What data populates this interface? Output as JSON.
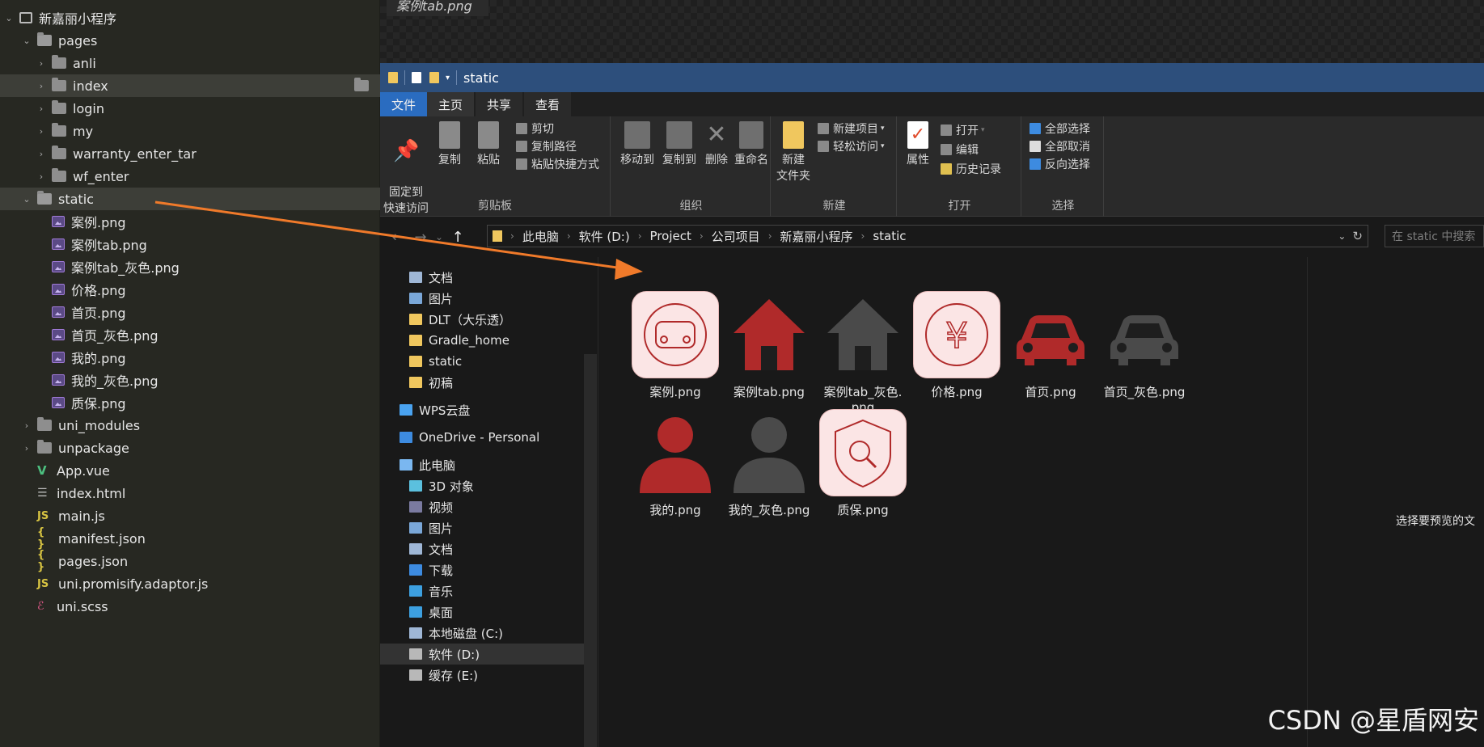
{
  "ide": {
    "project": "新嘉丽小程序",
    "items": [
      {
        "label": "pages",
        "type": "folder-open",
        "level": 1,
        "chev": "⌄"
      },
      {
        "label": "anli",
        "type": "folder",
        "level": 2,
        "chev": "›"
      },
      {
        "label": "index",
        "type": "folder",
        "level": 2,
        "chev": "›",
        "selected": true
      },
      {
        "label": "login",
        "type": "folder",
        "level": 2,
        "chev": "›"
      },
      {
        "label": "my",
        "type": "folder",
        "level": 2,
        "chev": "›"
      },
      {
        "label": "warranty_enter_tar",
        "type": "folder",
        "level": 2,
        "chev": "›"
      },
      {
        "label": "wf_enter",
        "type": "folder",
        "level": 2,
        "chev": "›"
      },
      {
        "label": "static",
        "type": "folder-open",
        "level": 1,
        "chev": "⌄",
        "selected": true
      },
      {
        "label": "案例.png",
        "type": "image",
        "level": 2
      },
      {
        "label": "案例tab.png",
        "type": "image",
        "level": 2
      },
      {
        "label": "案例tab_灰色.png",
        "type": "image",
        "level": 2
      },
      {
        "label": "价格.png",
        "type": "image",
        "level": 2
      },
      {
        "label": "首页.png",
        "type": "image",
        "level": 2
      },
      {
        "label": "首页_灰色.png",
        "type": "image",
        "level": 2
      },
      {
        "label": "我的.png",
        "type": "image",
        "level": 2
      },
      {
        "label": "我的_灰色.png",
        "type": "image",
        "level": 2
      },
      {
        "label": "质保.png",
        "type": "image",
        "level": 2
      },
      {
        "label": "uni_modules",
        "type": "folder",
        "level": 1,
        "chev": "›"
      },
      {
        "label": "unpackage",
        "type": "folder",
        "level": 1,
        "chev": "›"
      },
      {
        "label": "App.vue",
        "type": "vue",
        "level": 1
      },
      {
        "label": "index.html",
        "type": "html",
        "level": 1
      },
      {
        "label": "main.js",
        "type": "js",
        "level": 1
      },
      {
        "label": "manifest.json",
        "type": "json",
        "level": 1
      },
      {
        "label": "pages.json",
        "type": "json",
        "level": 1
      },
      {
        "label": "uni.promisify.adaptor.js",
        "type": "js",
        "level": 1
      },
      {
        "label": "uni.scss",
        "type": "scss",
        "level": 1
      }
    ]
  },
  "viewer": {
    "tab": "案例tab.png"
  },
  "explorer": {
    "title": "static",
    "tabs": [
      "文件",
      "主页",
      "共享",
      "查看"
    ],
    "ribbon": {
      "pin": "固定到\n快速访问",
      "copy": "复制",
      "paste": "粘贴",
      "cut": "剪切",
      "copy_path": "复制路径",
      "paste_shortcut": "粘贴快捷方式",
      "clipboard": "剪贴板",
      "move_to": "移动到",
      "copy_to": "复制到",
      "delete": "删除",
      "rename": "重命名",
      "organize": "组织",
      "new_folder": "新建\n文件夹",
      "new_item": "新建项目",
      "easy_access": "轻松访问",
      "new": "新建",
      "properties": "属性",
      "open": "打开",
      "edit": "编辑",
      "history": "历史记录",
      "open_group": "打开",
      "select_all": "全部选择",
      "select_none": "全部取消",
      "invert": "反向选择",
      "select": "选择"
    },
    "breadcrumb": [
      "此电脑",
      "软件 (D:)",
      "Project",
      "公司项目",
      "新嘉丽小程序",
      "static"
    ],
    "search_placeholder": "在 static 中搜索",
    "nav": [
      {
        "label": "文档",
        "icon": "document-icon",
        "color": "#9fb7d6"
      },
      {
        "label": "图片",
        "icon": "picture-icon",
        "color": "#7aa7d8"
      },
      {
        "label": "DLT（大乐透）",
        "icon": "folder-icon",
        "color": "#f0c75e"
      },
      {
        "label": "Gradle_home",
        "icon": "folder-icon",
        "color": "#f0c75e"
      },
      {
        "label": "static",
        "icon": "folder-icon",
        "color": "#f0c75e"
      },
      {
        "label": "初稿",
        "icon": "folder-icon",
        "color": "#f0c75e"
      },
      {
        "label": "WPS云盘",
        "icon": "cloud-icon",
        "color": "#4aa3f0"
      },
      {
        "label": "OneDrive - Personal",
        "icon": "onedrive-icon",
        "color": "#3d8be0"
      },
      {
        "label": "此电脑",
        "icon": "computer-icon",
        "color": "#7ab7f0"
      },
      {
        "label": "3D 对象",
        "icon": "cube-icon",
        "color": "#5bc0de"
      },
      {
        "label": "视频",
        "icon": "video-icon",
        "color": "#7a7aa0"
      },
      {
        "label": "图片",
        "icon": "picture-icon",
        "color": "#7aa7d8"
      },
      {
        "label": "文档",
        "icon": "document-icon",
        "color": "#9fb7d6"
      },
      {
        "label": "下载",
        "icon": "download-icon",
        "color": "#3d8be0"
      },
      {
        "label": "音乐",
        "icon": "music-icon",
        "color": "#3da0e0"
      },
      {
        "label": "桌面",
        "icon": "desktop-icon",
        "color": "#3da0e0"
      },
      {
        "label": "本地磁盘 (C:)",
        "icon": "drive-icon",
        "color": "#9fb7d6"
      },
      {
        "label": "软件 (D:)",
        "icon": "drive-icon",
        "color": "#b8b8b8",
        "selected": true
      },
      {
        "label": "缓存 (E:)",
        "icon": "drive-icon",
        "color": "#b8b8b8"
      }
    ],
    "files": [
      {
        "name": "案例.png",
        "icon": "car-badge-pink"
      },
      {
        "name": "案例tab.png",
        "icon": "house-red"
      },
      {
        "name": "案例tab_灰色.\npng",
        "icon": "house-gray"
      },
      {
        "name": "价格.png",
        "icon": "yen-badge-pink"
      },
      {
        "name": "首页.png",
        "icon": "car-red"
      },
      {
        "name": "首页_灰色.png",
        "icon": "car-gray"
      },
      {
        "name": "我的.png",
        "icon": "person-red"
      },
      {
        "name": "我的_灰色.png",
        "icon": "person-gray"
      },
      {
        "name": "质保.png",
        "icon": "shield-badge-pink"
      }
    ],
    "preview_hint": "选择要预览的文"
  },
  "watermark": "CSDN @星盾网安",
  "colors": {
    "red": "#b02a2a",
    "gray": "#4a4a4a",
    "pink": "#fbe5e5",
    "arrow": "#f07a2a"
  }
}
